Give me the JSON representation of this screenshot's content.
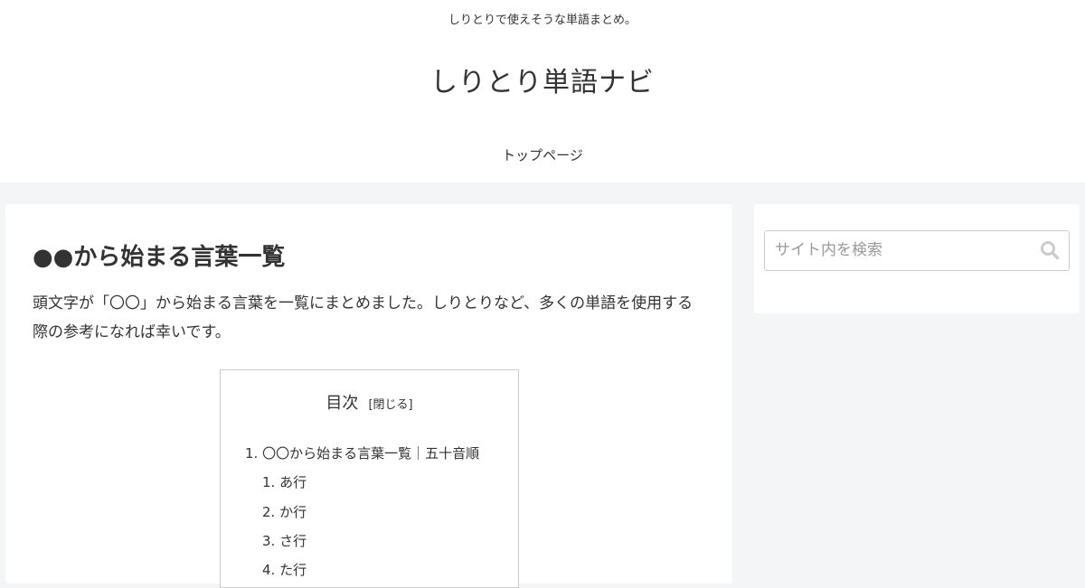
{
  "header": {
    "tagline": "しりとりで使えそうな単語まとめ。",
    "site_title": "しりとり単語ナビ",
    "nav": [
      {
        "label": "トップページ"
      }
    ]
  },
  "article": {
    "title": "●●から始まる言葉一覧",
    "intro": "頭文字が「〇〇」から始まる言葉を一覧にまとめました。しりとりなど、多くの単語を使用する際の参考になれば幸いです。",
    "toc": {
      "title": "目次",
      "toggle_label": "[閉じる]",
      "items": [
        {
          "number": "1.",
          "label": "〇〇から始まる言葉一覧｜五十音順",
          "children": [
            {
              "number": "1.",
              "label": "あ行"
            },
            {
              "number": "2.",
              "label": "か行"
            },
            {
              "number": "3.",
              "label": "さ行"
            },
            {
              "number": "4.",
              "label": "た行"
            }
          ]
        }
      ]
    }
  },
  "sidebar": {
    "search": {
      "placeholder": "サイト内を検索",
      "value": "",
      "button_icon": "search-icon"
    }
  },
  "colors": {
    "page_background": "#f4f5f7",
    "card_background": "#ffffff",
    "text": "#333333",
    "border": "#cccccc",
    "placeholder": "#999999",
    "icon": "#cccccc"
  }
}
